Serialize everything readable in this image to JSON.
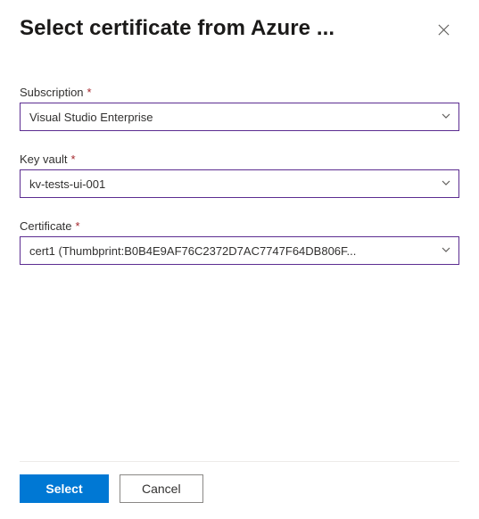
{
  "header": {
    "title": "Select certificate from Azure ..."
  },
  "fields": {
    "subscription": {
      "label": "Subscription",
      "required": "*",
      "value": "Visual Studio Enterprise"
    },
    "keyVault": {
      "label": "Key vault",
      "required": "*",
      "value": "kv-tests-ui-001"
    },
    "certificate": {
      "label": "Certificate",
      "required": "*",
      "value": "cert1 (Thumbprint:B0B4E9AF76C2372D7AC7747F64DB806F..."
    }
  },
  "footer": {
    "primary": "Select",
    "secondary": "Cancel"
  }
}
